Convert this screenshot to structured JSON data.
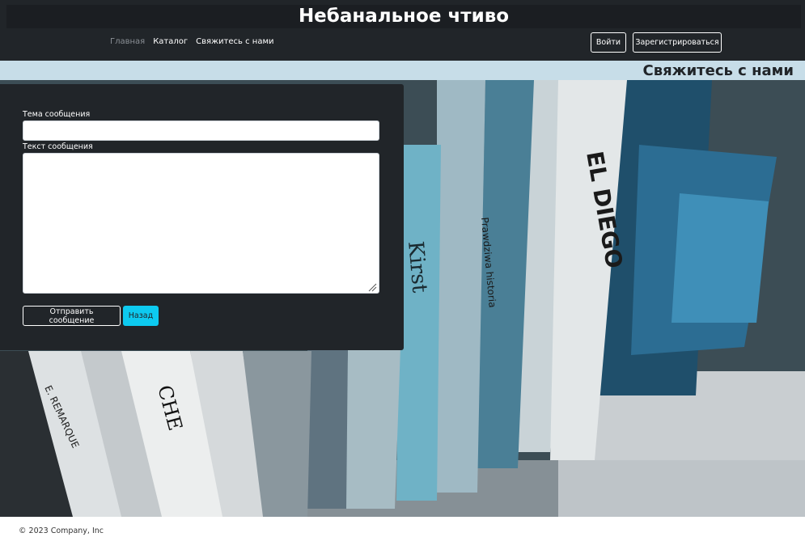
{
  "site": {
    "title": "Небанальное чтиво"
  },
  "nav": {
    "items": [
      {
        "label": "Главная",
        "state": "muted"
      },
      {
        "label": "Каталог"
      },
      {
        "label": "Свяжитесь с нами"
      }
    ]
  },
  "auth": {
    "login_label": "Войти",
    "register_label": "Зарегистрироваться"
  },
  "page": {
    "heading": "Свяжитесь с нами"
  },
  "form": {
    "subject_label": "Тема сообщения",
    "subject_value": "",
    "message_label": "Текст сообщения",
    "message_value": "",
    "send_label": "Отправить сообщение",
    "back_label": "Назад"
  },
  "footer": {
    "copyright": "© 2023 Company, Inc"
  },
  "colors": {
    "header_bg": "#212529",
    "title_bar_bg": "#c7dde8",
    "back_button": "#0dcaf0"
  }
}
